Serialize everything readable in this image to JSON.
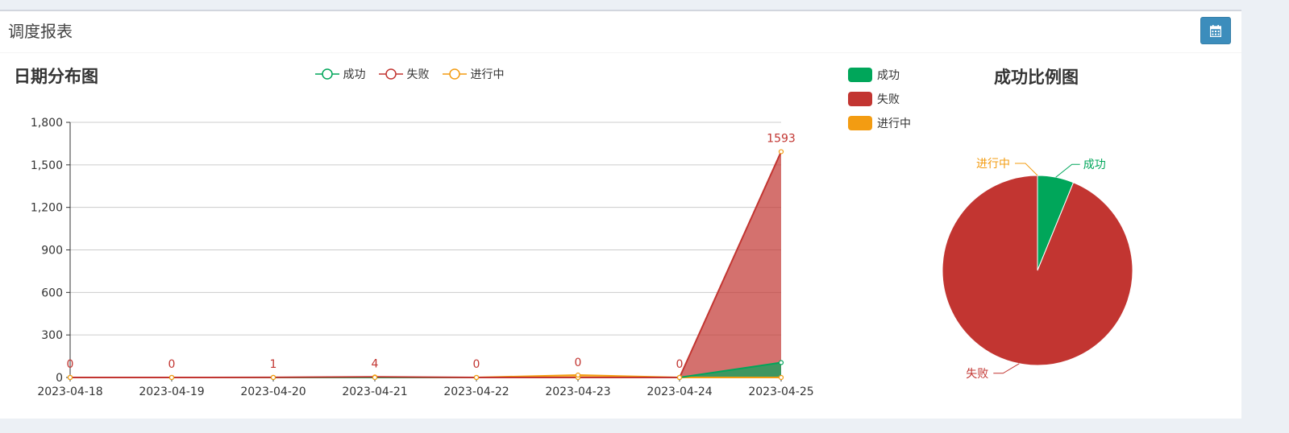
{
  "header": {
    "title": "调度报表",
    "calendar_icon": "calendar-icon"
  },
  "colors": {
    "success": "#00a65a",
    "fail": "#c23531",
    "running": "#f39c12",
    "button": "#3c8dbc"
  },
  "line_chart": {
    "title": "日期分布图",
    "legend": [
      "成功",
      "失败",
      "进行中"
    ]
  },
  "pie_chart": {
    "title": "成功比例图",
    "legend": [
      "成功",
      "失败",
      "进行中"
    ]
  },
  "chart_data": [
    {
      "type": "area",
      "title": "日期分布图",
      "categories": [
        "2023-04-18",
        "2023-04-19",
        "2023-04-20",
        "2023-04-21",
        "2023-04-22",
        "2023-04-23",
        "2023-04-24",
        "2023-04-25"
      ],
      "ylim": [
        0,
        1800
      ],
      "yticks": [
        0,
        300,
        600,
        900,
        1200,
        1500,
        1800
      ],
      "ytick_labels": [
        "0",
        "300",
        "600",
        "900",
        "1,200",
        "1,500",
        "1,800"
      ],
      "grid": true,
      "legend_position": "top",
      "series": [
        {
          "name": "成功",
          "color": "#00a65a",
          "values": [
            0,
            0,
            0,
            0,
            0,
            0,
            0,
            105
          ]
        },
        {
          "name": "失败",
          "color": "#c23531",
          "values": [
            0,
            0,
            1,
            4,
            0,
            0,
            0,
            1593
          ]
        },
        {
          "name": "进行中",
          "color": "#f39c12",
          "values": [
            0,
            0,
            0,
            0,
            0,
            17,
            0,
            0
          ]
        }
      ],
      "data_labels": [
        "0",
        "0",
        "1",
        "4",
        "0",
        "0",
        "0",
        "1593"
      ]
    },
    {
      "type": "pie",
      "title": "成功比例图",
      "legend_position": "top-left",
      "slices": [
        {
          "label": "成功",
          "value": 105,
          "color": "#00a65a"
        },
        {
          "label": "失败",
          "value": 1598,
          "color": "#c23531"
        },
        {
          "label": "进行中",
          "value": 0,
          "color": "#f39c12"
        }
      ]
    }
  ]
}
